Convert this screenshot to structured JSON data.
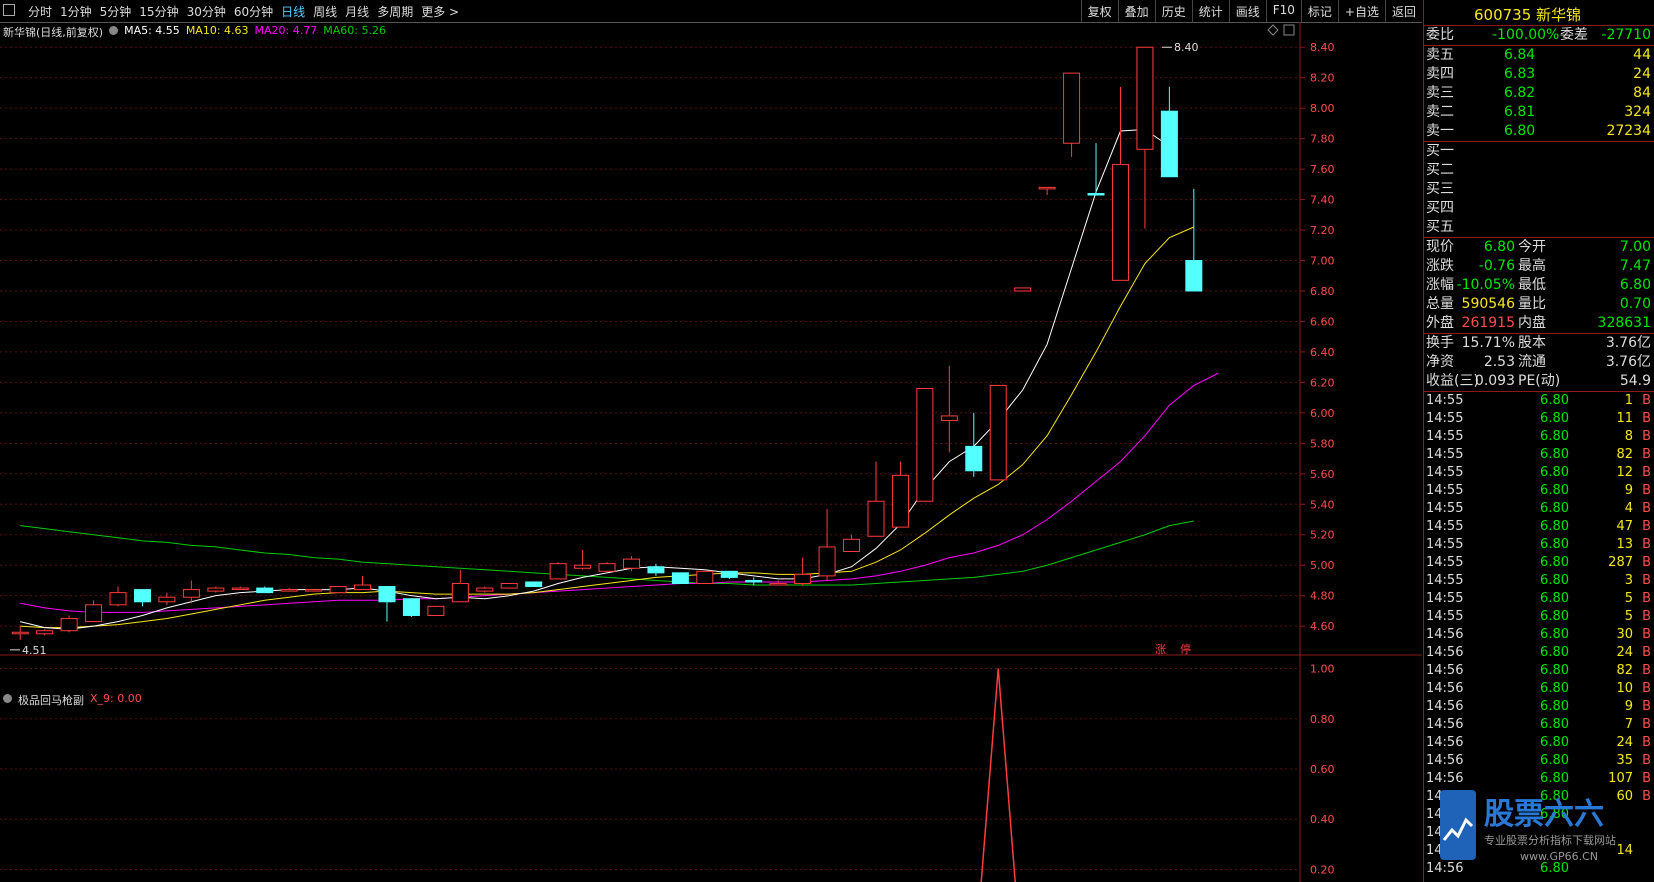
{
  "toolbar": {
    "tabs": [
      "分时",
      "1分钟",
      "5分钟",
      "15分钟",
      "30分钟",
      "60分钟",
      "日线",
      "周线",
      "月线",
      "多周期",
      "更多 >"
    ],
    "active_tab": "日线",
    "tools": [
      "复权",
      "叠加",
      "历史",
      "统计",
      "画线",
      "F10",
      "标记",
      "+自选",
      "返回"
    ]
  },
  "legend": {
    "name": "新华锦(日线,前复权)",
    "ma5": "MA5: 4.55",
    "ma10": "MA10: 4.63",
    "ma20": "MA20: 4.77",
    "ma60": "MA60: 5.26",
    "colors": {
      "ma5": "#ffffff",
      "ma10": "#f8e71c",
      "ma20": "#ff00ff",
      "ma60": "#00cc00"
    }
  },
  "indicator": {
    "name": "极品回马枪副",
    "value": "X_9: 0.00"
  },
  "markers": {
    "high": "8.40",
    "low": "4.51",
    "zhang": "涨",
    "ting": "停"
  },
  "chart_data": {
    "type": "candlestick",
    "price_axis": {
      "ticks": [
        "8.40",
        "8.20",
        "8.00",
        "7.80",
        "7.60",
        "7.40",
        "7.20",
        "7.00",
        "6.80",
        "6.60",
        "6.40",
        "6.20",
        "6.00",
        "5.80",
        "5.60",
        "5.40",
        "5.20",
        "5.00",
        "4.80",
        "4.60"
      ],
      "range": [
        4.45,
        8.5
      ]
    },
    "indicator_axis": {
      "ticks": [
        "1.00",
        "0.80",
        "0.60",
        "0.40",
        "0.20"
      ],
      "range": [
        0.15,
        1.05
      ]
    },
    "candles": [
      {
        "o": 4.55,
        "c": 4.56,
        "h": 4.6,
        "l": 4.51
      },
      {
        "o": 4.55,
        "c": 4.57,
        "h": 4.58,
        "l": 4.54
      },
      {
        "o": 4.57,
        "c": 4.65,
        "h": 4.67,
        "l": 4.56
      },
      {
        "o": 4.63,
        "c": 4.74,
        "h": 4.77,
        "l": 4.63
      },
      {
        "o": 4.74,
        "c": 4.82,
        "h": 4.86,
        "l": 4.73
      },
      {
        "o": 4.84,
        "c": 4.76,
        "h": 4.84,
        "l": 4.73
      },
      {
        "o": 4.76,
        "c": 4.79,
        "h": 4.82,
        "l": 4.74
      },
      {
        "o": 4.79,
        "c": 4.84,
        "h": 4.9,
        "l": 4.75
      },
      {
        "o": 4.83,
        "c": 4.85,
        "h": 4.86,
        "l": 4.82
      },
      {
        "o": 4.85,
        "c": 4.85,
        "h": 4.86,
        "l": 4.84
      },
      {
        "o": 4.85,
        "c": 4.82,
        "h": 4.86,
        "l": 4.82
      },
      {
        "o": 4.83,
        "c": 4.84,
        "h": 4.85,
        "l": 4.83
      },
      {
        "o": 4.84,
        "c": 4.84,
        "h": 4.84,
        "l": 4.84
      },
      {
        "o": 4.82,
        "c": 4.86,
        "h": 4.86,
        "l": 4.82
      },
      {
        "o": 4.84,
        "c": 4.87,
        "h": 4.93,
        "l": 4.84
      },
      {
        "o": 4.86,
        "c": 4.76,
        "h": 4.86,
        "l": 4.63
      },
      {
        "o": 4.78,
        "c": 4.67,
        "h": 4.78,
        "l": 4.66
      },
      {
        "o": 4.67,
        "c": 4.73,
        "h": 4.73,
        "l": 4.67
      },
      {
        "o": 4.76,
        "c": 4.88,
        "h": 4.97,
        "l": 4.76
      },
      {
        "o": 4.83,
        "c": 4.85,
        "h": 4.86,
        "l": 4.82
      },
      {
        "o": 4.85,
        "c": 4.88,
        "h": 4.88,
        "l": 4.85
      },
      {
        "o": 4.89,
        "c": 4.86,
        "h": 4.89,
        "l": 4.86
      },
      {
        "o": 4.91,
        "c": 5.01,
        "h": 5.02,
        "l": 4.91
      },
      {
        "o": 4.98,
        "c": 5.0,
        "h": 5.1,
        "l": 4.97
      },
      {
        "o": 4.96,
        "c": 5.01,
        "h": 5.02,
        "l": 4.96
      },
      {
        "o": 4.98,
        "c": 5.04,
        "h": 5.06,
        "l": 4.96
      },
      {
        "o": 4.99,
        "c": 4.95,
        "h": 5.01,
        "l": 4.93
      },
      {
        "o": 4.95,
        "c": 4.88,
        "h": 4.95,
        "l": 4.88
      },
      {
        "o": 4.88,
        "c": 4.96,
        "h": 4.96,
        "l": 4.88
      },
      {
        "o": 4.96,
        "c": 4.92,
        "h": 4.96,
        "l": 4.91
      },
      {
        "o": 4.9,
        "c": 4.89,
        "h": 4.92,
        "l": 4.87
      },
      {
        "o": 4.88,
        "c": 4.88,
        "h": 4.9,
        "l": 4.87
      },
      {
        "o": 4.88,
        "c": 4.94,
        "h": 5.05,
        "l": 4.87
      },
      {
        "o": 4.93,
        "c": 5.12,
        "h": 5.37,
        "l": 4.9
      },
      {
        "o": 5.09,
        "c": 5.17,
        "h": 5.2,
        "l": 5.09
      },
      {
        "o": 5.19,
        "c": 5.42,
        "h": 5.68,
        "l": 5.19
      },
      {
        "o": 5.25,
        "c": 5.59,
        "h": 5.68,
        "l": 5.25
      },
      {
        "o": 5.42,
        "c": 6.16,
        "h": 6.16,
        "l": 5.42
      },
      {
        "o": 5.95,
        "c": 5.98,
        "h": 6.31,
        "l": 5.74
      },
      {
        "o": 5.78,
        "c": 5.62,
        "h": 6.0,
        "l": 5.58
      },
      {
        "o": 5.56,
        "c": 6.18,
        "h": 6.18,
        "l": 5.56
      },
      {
        "o": 6.8,
        "c": 6.82,
        "h": 6.82,
        "l": 6.8
      },
      {
        "o": 7.48,
        "c": 7.48,
        "h": 7.48,
        "l": 7.43
      },
      {
        "o": 7.77,
        "c": 8.23,
        "h": 8.23,
        "l": 7.68
      },
      {
        "o": 7.44,
        "c": 7.43,
        "h": 7.77,
        "l": 7.43
      },
      {
        "o": 6.87,
        "c": 7.63,
        "h": 8.14,
        "l": 6.87
      },
      {
        "o": 7.73,
        "c": 8.4,
        "h": 8.4,
        "l": 7.21
      },
      {
        "o": 7.98,
        "c": 7.55,
        "h": 8.14,
        "l": 7.55
      },
      {
        "o": 7.0,
        "c": 6.8,
        "h": 7.47,
        "l": 6.8
      }
    ],
    "ma5": [
      4.63,
      4.59,
      4.58,
      4.6,
      4.63,
      4.67,
      4.72,
      4.76,
      4.8,
      4.82,
      4.83,
      4.84,
      4.84,
      4.84,
      4.85,
      4.83,
      4.8,
      4.78,
      4.79,
      4.78,
      4.8,
      4.83,
      4.88,
      4.92,
      4.95,
      4.98,
      4.99,
      4.98,
      4.97,
      4.95,
      4.93,
      4.91,
      4.91,
      4.94,
      4.99,
      5.11,
      5.27,
      5.5,
      5.68,
      5.78,
      5.95,
      6.15,
      6.45,
      6.95,
      7.45,
      7.85,
      7.86,
      7.75
    ],
    "ma10": [
      4.6,
      4.59,
      4.59,
      4.6,
      4.61,
      4.63,
      4.65,
      4.68,
      4.71,
      4.74,
      4.77,
      4.79,
      4.81,
      4.82,
      4.82,
      4.83,
      4.82,
      4.81,
      4.81,
      4.81,
      4.81,
      4.82,
      4.84,
      4.86,
      4.88,
      4.9,
      4.92,
      4.93,
      4.94,
      4.95,
      4.95,
      4.94,
      4.94,
      4.95,
      4.96,
      5.02,
      5.1,
      5.21,
      5.33,
      5.44,
      5.53,
      5.66,
      5.85,
      6.12,
      6.4,
      6.7,
      6.98,
      7.15,
      7.22
    ],
    "ma20": [
      4.75,
      4.72,
      4.7,
      4.69,
      4.69,
      4.69,
      4.7,
      4.71,
      4.72,
      4.73,
      4.74,
      4.75,
      4.76,
      4.77,
      4.77,
      4.77,
      4.78,
      4.78,
      4.79,
      4.8,
      4.81,
      4.82,
      4.83,
      4.84,
      4.85,
      4.86,
      4.87,
      4.88,
      4.88,
      4.89,
      4.89,
      4.89,
      4.89,
      4.9,
      4.91,
      4.93,
      4.96,
      5.0,
      5.05,
      5.08,
      5.13,
      5.2,
      5.3,
      5.42,
      5.55,
      5.68,
      5.85,
      6.05,
      6.18,
      6.26
    ],
    "ma60": [
      5.26,
      5.24,
      5.22,
      5.2,
      5.18,
      5.16,
      5.15,
      5.13,
      5.12,
      5.1,
      5.08,
      5.07,
      5.05,
      5.04,
      5.02,
      5.01,
      5.0,
      4.99,
      4.98,
      4.97,
      4.96,
      4.95,
      4.94,
      4.93,
      4.92,
      4.91,
      4.9,
      4.89,
      4.88,
      4.88,
      4.87,
      4.87,
      4.87,
      4.87,
      4.87,
      4.88,
      4.89,
      4.9,
      4.91,
      4.92,
      4.94,
      4.96,
      5.0,
      5.05,
      5.1,
      5.15,
      5.2,
      5.26,
      5.29
    ],
    "indicator_series": {
      "name": "X_9",
      "spike_index": 40,
      "spike_value": 1.0,
      "base_value": 0.0
    }
  },
  "quote": {
    "code_name": "600735 新华锦",
    "weibi_label": "委比",
    "weibi_value": "-100.00%",
    "weicha_label": "委差",
    "weicha_value": "-27710",
    "asks": [
      {
        "label": "卖五",
        "price": "6.84",
        "vol": "44"
      },
      {
        "label": "卖四",
        "price": "6.83",
        "vol": "24"
      },
      {
        "label": "卖三",
        "price": "6.82",
        "vol": "84"
      },
      {
        "label": "卖二",
        "price": "6.81",
        "vol": "324"
      },
      {
        "label": "卖一",
        "price": "6.80",
        "vol": "27234"
      }
    ],
    "bids": [
      "买一",
      "买二",
      "买三",
      "买四",
      "买五"
    ],
    "stats": [
      {
        "l1": "现价",
        "v1": "6.80",
        "c1": "grn",
        "l2": "今开",
        "v2": "7.00",
        "c2": "grn"
      },
      {
        "l1": "涨跌",
        "v1": "-0.76",
        "c1": "grn",
        "l2": "最高",
        "v2": "7.47",
        "c2": "grn"
      },
      {
        "l1": "涨幅",
        "v1": "-10.05%",
        "c1": "grn",
        "l2": "最低",
        "v2": "6.80",
        "c2": "grn"
      },
      {
        "l1": "总量",
        "v1": "590546",
        "c1": "yel",
        "l2": "量比",
        "v2": "0.70",
        "c2": "grn"
      },
      {
        "l1": "外盘",
        "v1": "261915",
        "c1": "red",
        "l2": "内盘",
        "v2": "328631",
        "c2": "grn"
      }
    ],
    "fund": [
      {
        "l1": "换手",
        "v1": "15.71%",
        "l2": "股本",
        "v2": "3.76亿"
      },
      {
        "l1": "净资",
        "v1": "2.53",
        "l2": "流通",
        "v2": "3.76亿"
      },
      {
        "l1": "收益(三)",
        "v1": "0.093",
        "l2": "PE(动)",
        "v2": "54.9"
      }
    ],
    "ticks": [
      {
        "t": "14:55",
        "p": "6.80",
        "v": "1",
        "s": "B"
      },
      {
        "t": "14:55",
        "p": "6.80",
        "v": "11",
        "s": "B"
      },
      {
        "t": "14:55",
        "p": "6.80",
        "v": "8",
        "s": "B"
      },
      {
        "t": "14:55",
        "p": "6.80",
        "v": "82",
        "s": "B"
      },
      {
        "t": "14:55",
        "p": "6.80",
        "v": "12",
        "s": "B"
      },
      {
        "t": "14:55",
        "p": "6.80",
        "v": "9",
        "s": "B"
      },
      {
        "t": "14:55",
        "p": "6.80",
        "v": "4",
        "s": "B"
      },
      {
        "t": "14:55",
        "p": "6.80",
        "v": "47",
        "s": "B"
      },
      {
        "t": "14:55",
        "p": "6.80",
        "v": "13",
        "s": "B"
      },
      {
        "t": "14:55",
        "p": "6.80",
        "v": "287",
        "s": "B"
      },
      {
        "t": "14:55",
        "p": "6.80",
        "v": "3",
        "s": "B"
      },
      {
        "t": "14:55",
        "p": "6.80",
        "v": "5",
        "s": "B"
      },
      {
        "t": "14:55",
        "p": "6.80",
        "v": "5",
        "s": "B"
      },
      {
        "t": "14:56",
        "p": "6.80",
        "v": "30",
        "s": "B"
      },
      {
        "t": "14:56",
        "p": "6.80",
        "v": "24",
        "s": "B"
      },
      {
        "t": "14:56",
        "p": "6.80",
        "v": "82",
        "s": "B"
      },
      {
        "t": "14:56",
        "p": "6.80",
        "v": "10",
        "s": "B"
      },
      {
        "t": "14:56",
        "p": "6.80",
        "v": "9",
        "s": "B"
      },
      {
        "t": "14:56",
        "p": "6.80",
        "v": "7",
        "s": "B"
      },
      {
        "t": "14:56",
        "p": "6.80",
        "v": "24",
        "s": "B"
      },
      {
        "t": "14:56",
        "p": "6.80",
        "v": "35",
        "s": "B"
      },
      {
        "t": "14:56",
        "p": "6.80",
        "v": "107",
        "s": "B"
      },
      {
        "t": "14:56",
        "p": "6.80",
        "v": "60",
        "s": "B"
      },
      {
        "t": "14:56",
        "p": "6.80",
        "v": "",
        "s": ""
      },
      {
        "t": "14:56",
        "p": "",
        "v": "",
        "s": ""
      },
      {
        "t": "14:56",
        "p": "",
        "v": "14",
        "s": ""
      },
      {
        "t": "14:56",
        "p": "6.80",
        "v": "",
        "s": ""
      }
    ]
  },
  "watermark": {
    "brand": "股票六六",
    "slogan": "专业股票分析指标下载网站",
    "url": "www.GP66.CN"
  },
  "colors": {
    "up": "#ff3b3b",
    "down": "#54ffff",
    "frame": "#8b1a1a",
    "grid": "#5a1010",
    "axis_text": "#ff4d4d"
  }
}
